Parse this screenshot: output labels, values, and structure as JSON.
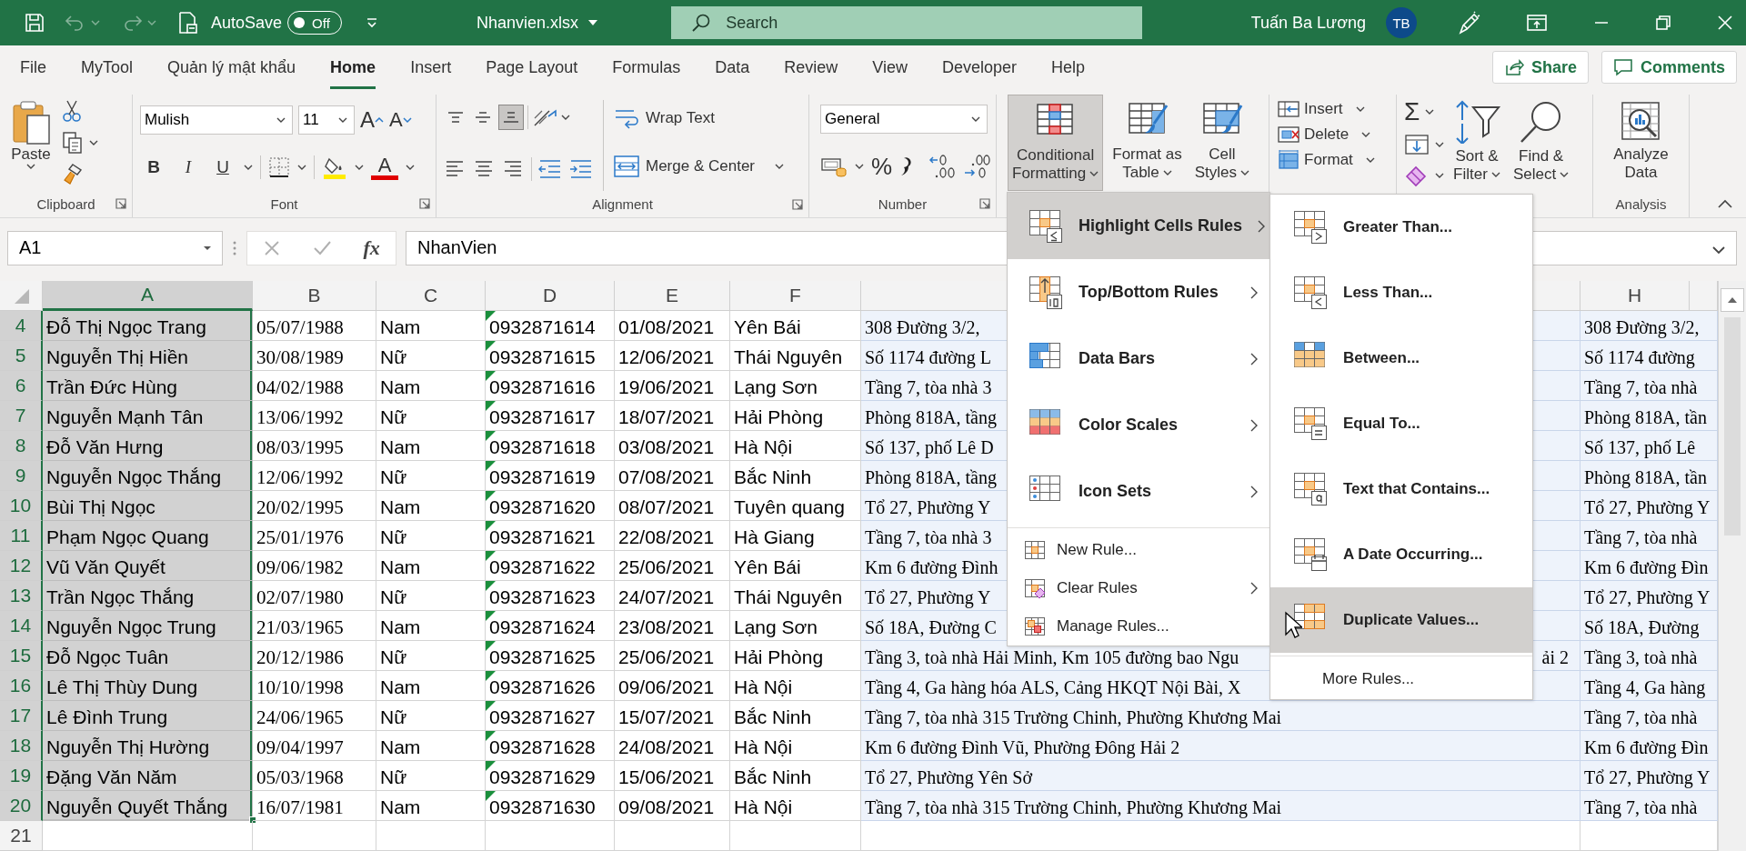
{
  "title_bar": {
    "undo": {
      "disabled": true
    },
    "redo": {
      "disabled": true
    },
    "autosave_label": "AutoSave",
    "autosave": {
      "on": false,
      "state": "Off"
    },
    "file_name": "Nhanvien.xlsx",
    "search_placeholder": "Search",
    "user_name": "Tuấn Ba Lương",
    "user_initials": "TB"
  },
  "tabs": [
    {
      "label": "File",
      "selected": false
    },
    {
      "label": "MyTool",
      "selected": false
    },
    {
      "label": "Quản lý mật khẩu",
      "selected": false
    },
    {
      "label": "Home",
      "selected": true
    },
    {
      "label": "Insert",
      "selected": false
    },
    {
      "label": "Page Layout",
      "selected": false
    },
    {
      "label": "Formulas",
      "selected": false
    },
    {
      "label": "Data",
      "selected": false
    },
    {
      "label": "Review",
      "selected": false
    },
    {
      "label": "View",
      "selected": false
    },
    {
      "label": "Developer",
      "selected": false
    },
    {
      "label": "Help",
      "selected": false
    }
  ],
  "share_button": "Share",
  "comments_button": "Comments",
  "ribbon": {
    "clipboard": {
      "paste": "Paste",
      "label": "Clipboard"
    },
    "font": {
      "font_name": "Mulish",
      "font_size": "11",
      "grow_glyph": "A",
      "shrink_glyph": "A",
      "bold": "B",
      "italic": "I",
      "underline": "U",
      "font_color_glyph": "A",
      "label": "Font"
    },
    "alignment": {
      "vertical": [
        {
          "selected": false
        },
        {
          "selected": false
        },
        {
          "selected": true
        }
      ],
      "wrap_text": "Wrap Text",
      "merge_center": "Merge & Center",
      "label": "Alignment"
    },
    "number": {
      "format": "General",
      "percent": "%",
      "label": "Number"
    },
    "styles": [
      {
        "lines": [
          "Conditional",
          "Formatting"
        ],
        "pressed": true
      },
      {
        "lines": [
          "Format as",
          "Table"
        ],
        "pressed": false
      },
      {
        "lines": [
          "Cell",
          "Styles"
        ],
        "pressed": false
      }
    ],
    "cells": [
      "Insert",
      "Delete",
      "Format"
    ],
    "editing": {
      "autosum_glyph": "Σ",
      "buttons": [
        {
          "lines": [
            "Sort &",
            "Filter"
          ]
        },
        {
          "lines": [
            "Find &",
            "Select"
          ]
        }
      ]
    },
    "analysis": {
      "lines": [
        "Analyze",
        "Data"
      ],
      "label": "Analysis"
    }
  },
  "formula_bar": {
    "name_box": "A1",
    "function_label": "fx",
    "formula": "NhanVien"
  },
  "sheet": {
    "columns": [
      {
        "label": "A",
        "selected": true
      },
      {
        "label": "B",
        "selected": false
      },
      {
        "label": "C",
        "selected": false
      },
      {
        "label": "D",
        "selected": false
      },
      {
        "label": "E",
        "selected": false
      },
      {
        "label": "F",
        "selected": false
      },
      {
        "selected": false
      },
      {
        "label": "H",
        "selected": false
      }
    ],
    "rows": [
      {
        "number": "4",
        "selected": true,
        "text_flag": true,
        "cells": [
          "Đỗ Thị Ngọc Trang",
          "05/07/1988",
          "Nam",
          "0932871614",
          "01/08/2021",
          "Yên Bái",
          "308 Đường 3/2,",
          "308 Đường 3/2,"
        ]
      },
      {
        "number": "5",
        "selected": true,
        "text_flag": true,
        "cells": [
          "Nguyễn Thị Hiền",
          "30/08/1989",
          "Nữ",
          "0932871615",
          "12/06/2021",
          "Thái Nguyên",
          "Số 1174 đường L",
          "Số 1174 đường"
        ]
      },
      {
        "number": "6",
        "selected": true,
        "text_flag": true,
        "cells": [
          "Trần Đức Hùng",
          "04/02/1988",
          "Nam",
          "0932871616",
          "19/06/2021",
          "Lạng Sơn",
          "Tầng 7, tòa nhà 3",
          "Tầng 7, tòa nhà"
        ]
      },
      {
        "number": "7",
        "selected": true,
        "text_flag": true,
        "cells": [
          "Nguyễn Mạnh Tân",
          "13/06/1992",
          "Nữ",
          "0932871617",
          "18/07/2021",
          "Hải Phòng",
          "Phòng 818A, tầng",
          "Phòng 818A, tần"
        ]
      },
      {
        "number": "8",
        "selected": true,
        "text_flag": true,
        "cells": [
          "Đỗ Văn Hưng",
          "08/03/1995",
          "Nam",
          "0932871618",
          "03/08/2021",
          "Hà Nội",
          "Số 137, phố Lê D",
          "Số 137, phố Lê"
        ]
      },
      {
        "number": "9",
        "selected": true,
        "text_flag": true,
        "cells": [
          "Nguyễn Ngọc Thắng",
          "12/06/1992",
          "Nữ",
          "0932871619",
          "07/08/2021",
          "Bắc Ninh",
          "Phòng 818A, tầng",
          "Phòng 818A, tần"
        ]
      },
      {
        "number": "10",
        "selected": true,
        "text_flag": true,
        "cells": [
          "Bùi Thị Ngọc",
          "20/02/1995",
          "Nam",
          "0932871620",
          "08/07/2021",
          "Tuyên quang",
          "Tổ 27, Phường Y",
          "Tổ 27, Phường Y"
        ]
      },
      {
        "number": "11",
        "selected": true,
        "text_flag": true,
        "cells": [
          "Phạm Ngọc Quang",
          "25/01/1976",
          "Nữ",
          "0932871621",
          "22/08/2021",
          "Hà Giang",
          "Tầng 7, tòa nhà 3",
          "Tầng 7, tòa nhà"
        ]
      },
      {
        "number": "12",
        "selected": true,
        "text_flag": true,
        "cells": [
          "Vũ Văn Quyết",
          "09/06/1982",
          "Nam",
          "0932871622",
          "25/06/2021",
          "Yên Bái",
          "Km 6 đường Đình",
          "Km 6 đường Đìn"
        ]
      },
      {
        "number": "13",
        "selected": true,
        "text_flag": true,
        "cells": [
          "Trần Ngọc Thắng",
          "02/07/1980",
          "Nữ",
          "0932871623",
          "24/07/2021",
          "Thái Nguyên",
          "Tổ 27, Phường Y",
          "Tổ 27, Phường Y"
        ]
      },
      {
        "number": "14",
        "selected": true,
        "text_flag": true,
        "cells": [
          "Nguyễn Ngọc Trung",
          "21/03/1965",
          "Nam",
          "0932871624",
          "23/08/2021",
          "Lạng Sơn",
          "Số 18A, Đường C",
          "Số 18A, Đường"
        ]
      },
      {
        "number": "15",
        "selected": true,
        "text_flag": true,
        "cells": [
          "Đỗ Ngọc Tuân",
          "20/12/1986",
          "Nữ",
          "0932871625",
          "25/06/2021",
          "Hải Phòng",
          "Tầng 3, toà nhà Hải Minh, Km 105 đường bao Ngu",
          "Tầng 3, toà nhà"
        ],
        "g_tail": "ải 2"
      },
      {
        "number": "16",
        "selected": true,
        "text_flag": true,
        "cells": [
          "Lê Thị Thùy Dung",
          "10/10/1998",
          "Nam",
          "0932871626",
          "09/06/2021",
          "Hà Nội",
          "Tầng 4, Ga hàng hóa ALS, Cảng HKQT Nội Bài, X",
          "Tầng 4, Ga hàng"
        ]
      },
      {
        "number": "17",
        "selected": true,
        "text_flag": true,
        "cells": [
          "Lê Đình Trung",
          "24/06/1965",
          "Nữ",
          "0932871627",
          "15/07/2021",
          "Bắc Ninh",
          "Tầng 7, tòa nhà 315 Trường Chinh, Phường Khương Mai",
          "Tầng 7, tòa nhà"
        ]
      },
      {
        "number": "18",
        "selected": true,
        "text_flag": true,
        "cells": [
          "Nguyễn Thị Hường",
          "09/04/1997",
          "Nam",
          "0932871628",
          "24/08/2021",
          "Hà Nội",
          "Km 6 đường Đình Vũ, Phường Đông Hải 2",
          "Km 6 đường Đìn"
        ]
      },
      {
        "number": "19",
        "selected": true,
        "text_flag": true,
        "cells": [
          "Đặng Văn Năm",
          "05/03/1968",
          "Nữ",
          "0932871629",
          "15/06/2021",
          "Bắc Ninh",
          "Tổ 27, Phường Yên Sở",
          "Tổ 27, Phường Y"
        ]
      },
      {
        "number": "20",
        "selected": true,
        "text_flag": true,
        "cells": [
          "Nguyễn Quyết Thắng",
          "16/07/1981",
          "Nam",
          "0932871630",
          "09/08/2021",
          "Hà Nội",
          "Tầng 7, tòa nhà 315 Trường Chinh, Phường Khương Mai",
          "Tầng 7, tòa nhà"
        ]
      },
      {
        "number": "21",
        "selected": false
      }
    ]
  },
  "conditional_formatting_menu": {
    "items": [
      {
        "label": "Highlight Cells Rules",
        "kind": "large",
        "submenu": true,
        "selected": true
      },
      {
        "label": "Top/Bottom Rules",
        "kind": "large",
        "submenu": true,
        "selected": false
      },
      {
        "label": "Data Bars",
        "kind": "large",
        "submenu": true,
        "selected": false
      },
      {
        "label": "Color Scales",
        "kind": "large",
        "submenu": true,
        "selected": false
      },
      {
        "label": "Icon Sets",
        "kind": "large",
        "submenu": true,
        "selected": false
      },
      {
        "label": "New Rule...",
        "kind": "small",
        "submenu": false,
        "selected": false
      },
      {
        "label": "Clear Rules",
        "kind": "small",
        "submenu": true,
        "selected": false
      },
      {
        "label": "Manage Rules...",
        "kind": "small",
        "submenu": false,
        "selected": false
      }
    ]
  },
  "highlight_cells_submenu": {
    "items": [
      {
        "label": "Greater Than...",
        "selected": false
      },
      {
        "label": "Less Than...",
        "selected": false
      },
      {
        "label": "Between...",
        "selected": false
      },
      {
        "label": "Equal To...",
        "selected": false
      },
      {
        "label": "Text that Contains...",
        "selected": false
      },
      {
        "label": "A Date Occurring...",
        "selected": false
      },
      {
        "label": "Duplicate Values...",
        "selected": true
      }
    ],
    "more_rules": "More Rules..."
  }
}
